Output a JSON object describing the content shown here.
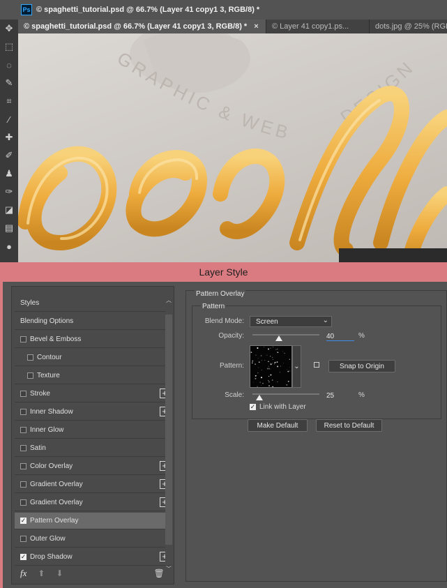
{
  "window": {
    "title": "© spaghetti_tutorial.psd @ 66.7% (Layer 41 copy1 3, RGB/8) *",
    "app_icon": "Ps"
  },
  "tabs": [
    {
      "label": "© spaghetti_tutorial.psd @ 66.7% (Layer 41 copy1 3, RGB/8) *",
      "close": "×"
    },
    {
      "label": "© Layer 41 copy1.ps..."
    },
    {
      "label": "dots.jpg @ 25% (RGB/"
    }
  ],
  "toolbar": {
    "icons": [
      "move-icon",
      "marquee-icon",
      "lasso-icon",
      "quick-select-icon",
      "crop-icon",
      "eyedropper-icon",
      "healing-icon",
      "brush-icon",
      "stamp-icon",
      "history-brush-icon",
      "eraser-icon",
      "gradient-icon",
      "blur-icon"
    ]
  },
  "canvas": {
    "emboss_line1": "GRAPHIC & WEB",
    "emboss_line2": "DESIGN",
    "bg_color": "#d6d2ce",
    "spaghetti_color": "#f2b64b"
  },
  "dialog": {
    "title": "Layer Style",
    "title_bar_color": "#d97b80",
    "styles": [
      {
        "label": "Styles",
        "checkbox": false,
        "checked": false,
        "plus": false,
        "indent": false
      },
      {
        "label": "Blending Options",
        "checkbox": false,
        "checked": false,
        "plus": false,
        "indent": false
      },
      {
        "label": "Bevel & Emboss",
        "checkbox": true,
        "checked": false,
        "plus": false,
        "indent": false
      },
      {
        "label": "Contour",
        "checkbox": true,
        "checked": false,
        "plus": false,
        "indent": true
      },
      {
        "label": "Texture",
        "checkbox": true,
        "checked": false,
        "plus": false,
        "indent": true
      },
      {
        "label": "Stroke",
        "checkbox": true,
        "checked": false,
        "plus": true,
        "indent": false
      },
      {
        "label": "Inner Shadow",
        "checkbox": true,
        "checked": false,
        "plus": true,
        "indent": false
      },
      {
        "label": "Inner Glow",
        "checkbox": true,
        "checked": false,
        "plus": false,
        "indent": false
      },
      {
        "label": "Satin",
        "checkbox": true,
        "checked": false,
        "plus": false,
        "indent": false
      },
      {
        "label": "Color Overlay",
        "checkbox": true,
        "checked": false,
        "plus": true,
        "indent": false
      },
      {
        "label": "Gradient Overlay",
        "checkbox": true,
        "checked": false,
        "plus": true,
        "indent": false
      },
      {
        "label": "Gradient Overlay",
        "checkbox": true,
        "checked": false,
        "plus": true,
        "indent": false
      },
      {
        "label": "Pattern Overlay",
        "checkbox": true,
        "checked": true,
        "plus": false,
        "indent": false,
        "selected": true
      },
      {
        "label": "Outer Glow",
        "checkbox": true,
        "checked": false,
        "plus": false,
        "indent": false
      },
      {
        "label": "Drop Shadow",
        "checkbox": true,
        "checked": true,
        "plus": true,
        "indent": false
      }
    ],
    "footer": {
      "fx_label": "fx",
      "up_icon": "arrow-up-icon",
      "down_icon": "arrow-down-icon",
      "trash_icon": "trash-icon"
    },
    "pattern_overlay": {
      "section_title": "Pattern Overlay",
      "group_title": "Pattern",
      "blend_mode_label": "Blend Mode:",
      "blend_mode_value": "Screen",
      "opacity_label": "Opacity:",
      "opacity_value": "40",
      "opacity_level": 0.4,
      "opacity_unit": "%",
      "pattern_label": "Pattern:",
      "snap_button": "Snap to Origin",
      "scale_label": "Scale:",
      "scale_value": "25",
      "scale_level": 0.1,
      "scale_unit": "%",
      "link_label": "Link with Layer",
      "link_checked": true,
      "make_default": "Make Default",
      "reset_default": "Reset to Default"
    }
  }
}
